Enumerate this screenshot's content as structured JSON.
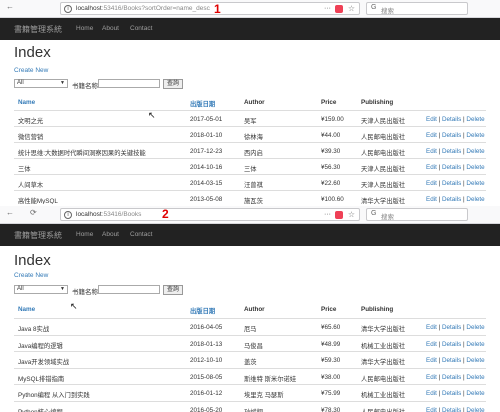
{
  "shots": [
    {
      "url_host": "localhost",
      "url_path": ":53416/Books?sortOrder=name_desc",
      "marker": "1",
      "search_placeholder": "搜索",
      "brand": "書籍管理系統",
      "nav": [
        "Home",
        "About",
        "Contact"
      ],
      "title": "Index",
      "create_label": "Create New",
      "select_value": "All",
      "filter_label": "书籍名称",
      "query_button": "查詢",
      "headers": [
        "Name",
        "出版日期",
        "Author",
        "Price",
        "Publishing"
      ],
      "actions": [
        "Edit",
        "Details",
        "Delete"
      ],
      "rows": [
        [
          "文明之光",
          "2017-05-01",
          "吴军",
          "¥159.00",
          "天津人民出版社"
        ],
        [
          "微信营销",
          "2018-01-10",
          "徐林海",
          "¥44.00",
          "人民邮电出版社"
        ],
        [
          "统计思维:大数据时代瞬间洞察因果的关键技能",
          "2017-12-23",
          "西内启",
          "¥39.30",
          "人民邮电出版社"
        ],
        [
          "三体",
          "2014-10-16",
          "三体",
          "¥56.30",
          "天津人民出版社"
        ],
        [
          "人间草木",
          "2014-03-15",
          "汪曾祺",
          "¥22.60",
          "天津人民出版社"
        ],
        [
          "高性能MySQL",
          "2013-05-08",
          "施瓦茨",
          "¥100.60",
          "清华大学出版社"
        ]
      ]
    },
    {
      "url_host": "localhost",
      "url_path": ":53416/Books",
      "marker": "2",
      "search_placeholder": "搜索",
      "brand": "書籍管理系統",
      "nav": [
        "Home",
        "About",
        "Contact"
      ],
      "title": "Index",
      "create_label": "Create New",
      "select_value": "All",
      "filter_label": "书籍名称",
      "query_button": "查詢",
      "headers": [
        "Name",
        "出版日期",
        "Author",
        "Price",
        "Publishing"
      ],
      "actions": [
        "Edit",
        "Details",
        "Delete"
      ],
      "rows": [
        [
          "Java 8实战",
          "2016-04-05",
          "厄马",
          "¥65.60",
          "清华大学出版社"
        ],
        [
          "Java编程的逻辑",
          "2018-01-13",
          "马俊昌",
          "¥48.99",
          "机械工业出版社"
        ],
        [
          "Java开发领域实战",
          "2012-10-10",
          "盖茨",
          "¥59.30",
          "清华大学出版社"
        ],
        [
          "MySQL排错指南",
          "2015-08-05",
          "斯维特 斯米尔诺娃",
          "¥38.00",
          "人民邮电出版社"
        ],
        [
          "Python编程 从入门到实践",
          "2016-01-12",
          "埃里克 马瑟斯",
          "¥75.99",
          "机械工业出版社"
        ],
        [
          "Python核心编程",
          "2016-05-20",
          "孙斌翔",
          "¥78.30",
          "人民邮电出版社"
        ]
      ]
    }
  ]
}
